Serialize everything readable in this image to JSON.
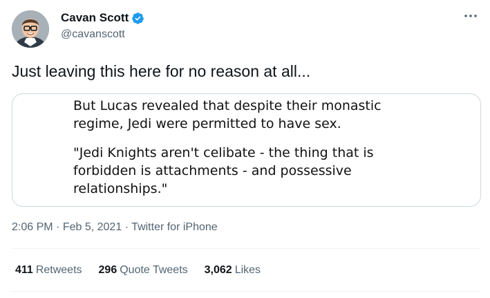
{
  "author": {
    "display_name": "Cavan Scott",
    "handle": "@cavanscott",
    "verified": true,
    "verified_color": "#1d9bf0",
    "avatar_icon": "profile-photo"
  },
  "tweet": {
    "text": "Just leaving this here for no reason at all..."
  },
  "quote_image": {
    "paragraphs": [
      [
        "But Lucas revealed that despite their monastic",
        "regime, Jedi were permitted to have sex."
      ],
      [
        "\"Jedi Knights aren't celibate - the thing that is",
        "forbidden is attachments - and possessive",
        "relationships.\""
      ]
    ]
  },
  "meta": {
    "time": "2:06 PM",
    "date": "Feb 5, 2021",
    "source": "Twitter for iPhone",
    "separator": "·"
  },
  "stats": {
    "retweets": {
      "count": "411",
      "label": "Retweets"
    },
    "quote_tweets": {
      "count": "296",
      "label": "Quote Tweets"
    },
    "likes": {
      "count": "3,062",
      "label": "Likes"
    }
  },
  "icons": {
    "more": "more-horizontal-icon"
  },
  "colors": {
    "text_primary": "#0f1419",
    "text_secondary": "#536471",
    "border": "#cfd9de"
  }
}
